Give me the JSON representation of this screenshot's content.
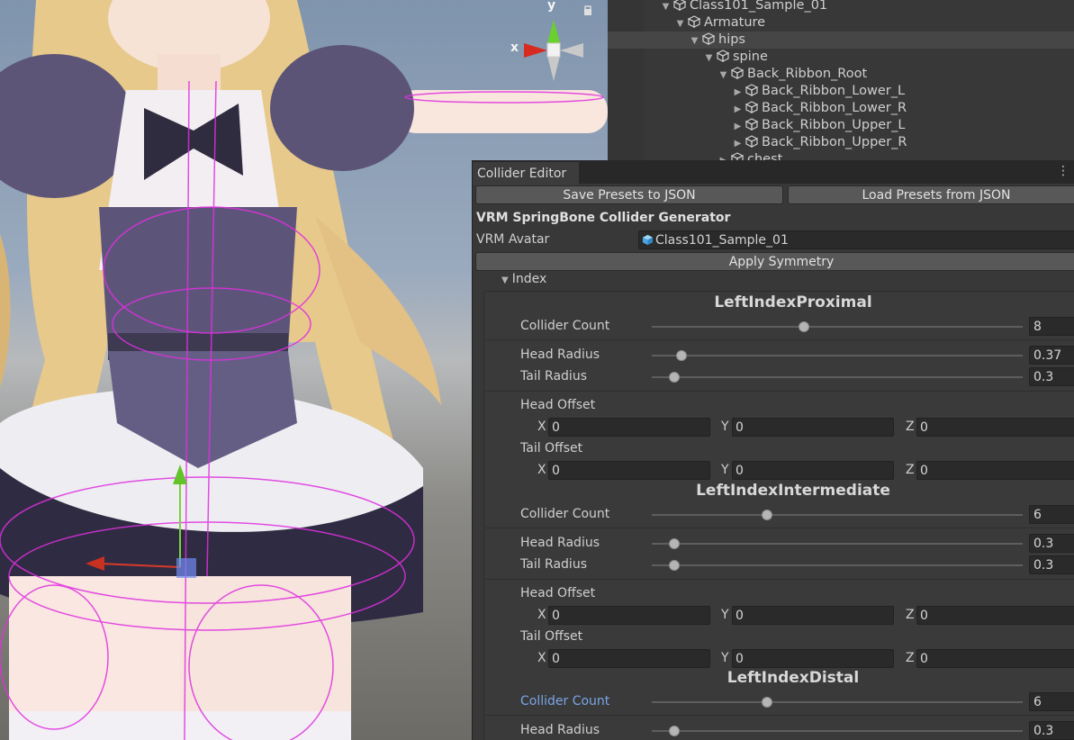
{
  "hierarchy": {
    "items": [
      {
        "label": "Class101_Sample_01",
        "depth": 0,
        "expanded": true
      },
      {
        "label": "Armature",
        "depth": 1,
        "expanded": true
      },
      {
        "label": "hips",
        "depth": 2,
        "expanded": true
      },
      {
        "label": "spine",
        "depth": 3,
        "expanded": true
      },
      {
        "label": "Back_Ribbon_Root",
        "depth": 4,
        "expanded": true
      },
      {
        "label": "Back_Ribbon_Lower_L",
        "depth": 5,
        "expanded": false
      },
      {
        "label": "Back_Ribbon_Lower_R",
        "depth": 5,
        "expanded": false
      },
      {
        "label": "Back_Ribbon_Upper_L",
        "depth": 5,
        "expanded": false
      },
      {
        "label": "Back_Ribbon_Upper_R",
        "depth": 5,
        "expanded": false
      },
      {
        "label": "chest",
        "depth": 4,
        "expanded": false
      }
    ]
  },
  "scene": {
    "gizmo": {
      "y_label": "y",
      "x_label": "x"
    }
  },
  "editor": {
    "tab_title": "Collider Editor",
    "menu_icon": "kebab-menu-icon",
    "save_button": "Save Presets to JSON",
    "load_button": "Load Presets from JSON",
    "section_title": "VRM SpringBone Collider Generator",
    "avatar_label": "VRM Avatar",
    "avatar_value": "Class101_Sample_01",
    "apply_button": "Apply Symmetry",
    "foldout_label": "Index",
    "labels": {
      "collider_count": "Collider Count",
      "head_radius": "Head Radius",
      "tail_radius": "Tail Radius",
      "head_offset": "Head Offset",
      "tail_offset": "Tail Offset",
      "x": "X",
      "y": "Y",
      "z": "Z"
    },
    "bones": [
      {
        "name": "LeftIndexProximal",
        "collider_count": {
          "value": "8",
          "fraction": 0.41
        },
        "head_radius": {
          "value": "0.37",
          "fraction": 0.08
        },
        "tail_radius": {
          "value": "0.3",
          "fraction": 0.06
        },
        "head_offset": {
          "x": "0",
          "y": "0",
          "z": "0"
        },
        "tail_offset": {
          "x": "0",
          "y": "0",
          "z": "0"
        }
      },
      {
        "name": "LeftIndexIntermediate",
        "collider_count": {
          "value": "6",
          "fraction": 0.31
        },
        "head_radius": {
          "value": "0.3",
          "fraction": 0.06
        },
        "tail_radius": {
          "value": "0.3",
          "fraction": 0.06
        },
        "head_offset": {
          "x": "0",
          "y": "0",
          "z": "0"
        },
        "tail_offset": {
          "x": "0",
          "y": "0",
          "z": "0"
        }
      },
      {
        "name": "LeftIndexDistal",
        "collider_count": {
          "value": "6",
          "fraction": 0.31
        },
        "head_radius": {
          "value": "0.3",
          "fraction": 0.06
        }
      }
    ]
  }
}
